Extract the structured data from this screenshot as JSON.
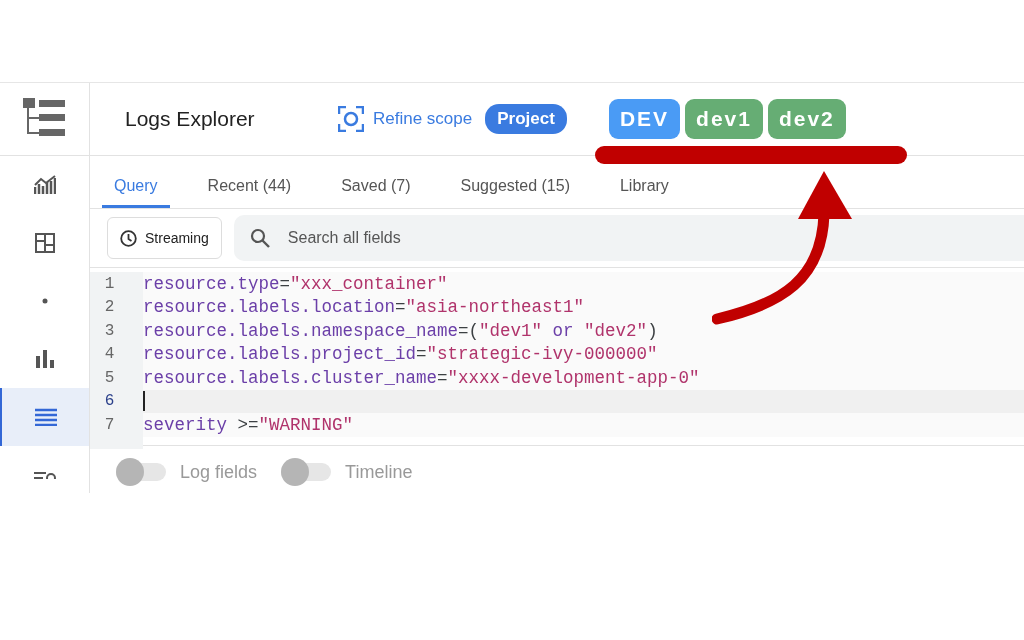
{
  "header": {
    "title": "Logs Explorer",
    "refine_scope": "Refine scope",
    "scope_chip": "Project"
  },
  "tags": [
    {
      "label": "DEV",
      "color": "#4a9bf5"
    },
    {
      "label": "dev1",
      "color": "#66ad74"
    },
    {
      "label": "dev2",
      "color": "#66ad74"
    }
  ],
  "sidebar": {
    "items": [
      {
        "kind": "chart",
        "selected": false
      },
      {
        "kind": "dashboard",
        "selected": false
      },
      {
        "kind": "dot",
        "selected": false
      },
      {
        "kind": "bars",
        "selected": false
      },
      {
        "kind": "list",
        "selected": true
      },
      {
        "kind": "search",
        "selected": false
      }
    ]
  },
  "tabs": [
    {
      "label": "Query",
      "selected": true
    },
    {
      "label": "Recent (44)",
      "selected": false
    },
    {
      "label": "Saved (7)",
      "selected": false
    },
    {
      "label": "Suggested (15)",
      "selected": false
    },
    {
      "label": "Library",
      "selected": false
    }
  ],
  "streaming": {
    "label": "Streaming"
  },
  "search": {
    "placeholder": "Search all fields"
  },
  "code": [
    {
      "number": "1",
      "current": false,
      "tokens": [
        {
          "text": "resource.type",
          "kind": "key"
        },
        {
          "text": "=",
          "kind": "op"
        },
        {
          "text": "\"xxx_container\"",
          "kind": "string"
        }
      ]
    },
    {
      "number": "2",
      "current": false,
      "tokens": [
        {
          "text": "resource.labels.location",
          "kind": "key"
        },
        {
          "text": "=",
          "kind": "op"
        },
        {
          "text": "\"asia-northeast1\"",
          "kind": "string"
        }
      ]
    },
    {
      "number": "3",
      "current": false,
      "tokens": [
        {
          "text": "resource.labels.namespace_name",
          "kind": "key"
        },
        {
          "text": "=(",
          "kind": "op"
        },
        {
          "text": "\"dev1\"",
          "kind": "string"
        },
        {
          "text": " or ",
          "kind": "key"
        },
        {
          "text": "\"dev2\"",
          "kind": "string"
        },
        {
          "text": ")",
          "kind": "op"
        }
      ]
    },
    {
      "number": "4",
      "current": false,
      "tokens": [
        {
          "text": "resource.labels.project_id",
          "kind": "key"
        },
        {
          "text": "=",
          "kind": "op"
        },
        {
          "text": "\"strategic-ivy-000000\"",
          "kind": "string"
        }
      ]
    },
    {
      "number": "5",
      "current": false,
      "tokens": [
        {
          "text": "resource.labels.cluster_name",
          "kind": "key"
        },
        {
          "text": "=",
          "kind": "op"
        },
        {
          "text": "\"xxxx-development-app-0\"",
          "kind": "string"
        }
      ]
    },
    {
      "number": "6",
      "current": true
    },
    {
      "number": "7",
      "current": false,
      "tokens": [
        {
          "text": "severity",
          "kind": "key"
        },
        {
          "text": " >=",
          "kind": "op"
        },
        {
          "text": "\"WARNING\"",
          "kind": "string"
        }
      ]
    }
  ],
  "toggles": [
    {
      "label": "Log fields",
      "on": false
    },
    {
      "label": "Timeline",
      "on": false
    }
  ]
}
